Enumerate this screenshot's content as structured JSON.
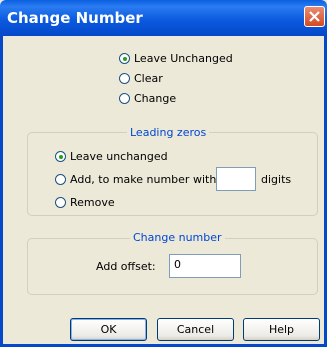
{
  "window": {
    "title": "Change Number"
  },
  "top_options": [
    "Leave Unchanged",
    "Clear",
    "Change"
  ],
  "leading_zeros": {
    "legend": "Leading zeros",
    "options": [
      "Leave unchanged",
      "Add, to make number with:",
      "Remove"
    ],
    "digits_value": "",
    "digits_suffix": "digits"
  },
  "change_number": {
    "legend": "Change number",
    "offset_label": "Add offset:",
    "offset_value": "0"
  },
  "buttons": {
    "ok": "OK",
    "cancel": "Cancel",
    "help": "Help"
  }
}
